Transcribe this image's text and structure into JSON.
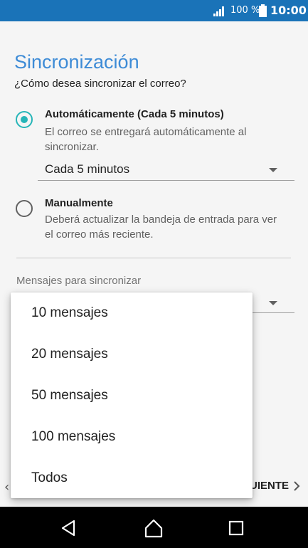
{
  "status_bar": {
    "battery_text": "100 %",
    "time": "10:00",
    "icons": [
      "signal-icon",
      "battery-icon"
    ]
  },
  "screen": {
    "title": "Sincronización",
    "subtitle": "¿Cómo desea sincronizar el correo?"
  },
  "options": [
    {
      "title": "Automáticamente (Cada 5 minutos)",
      "description": "El correo se entregará automáticamente al sincronizar.",
      "selected": true
    },
    {
      "title": "Manualmente",
      "description": "Deberá actualizar la bandeja de entrada para ver el correo más reciente.",
      "selected": false
    }
  ],
  "frequency_select": {
    "value": "Cada 5 minutos"
  },
  "messages_section": {
    "label": "Mensajes para sincronizar"
  },
  "dropdown": {
    "items": [
      "10 mensajes",
      "20 mensajes",
      "50 mensajes",
      "100 mensajes",
      "Todos"
    ]
  },
  "footer": {
    "next_label": "SIGUIENTE"
  },
  "colors": {
    "status_bar": "#1a73b8",
    "title": "#3d8bd6",
    "accent": "#26b5b8",
    "nav_bar": "#000000"
  },
  "nav_bar": {
    "icons": [
      "back-icon",
      "home-icon",
      "recents-icon"
    ]
  }
}
